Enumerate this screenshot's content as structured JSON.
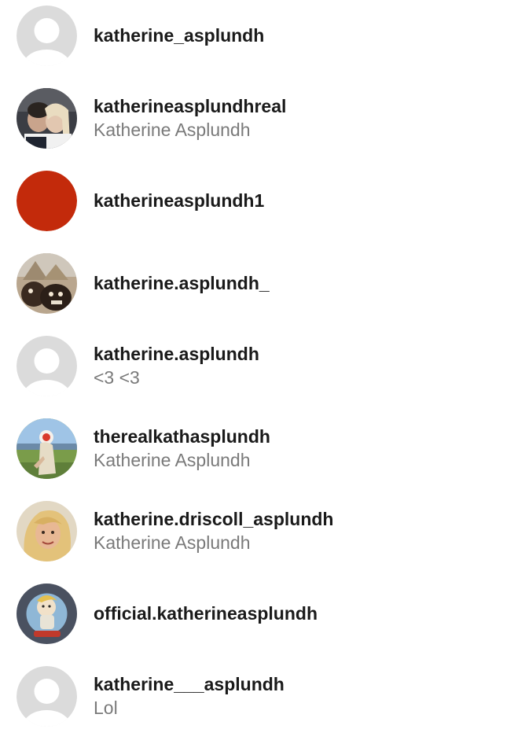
{
  "results": [
    {
      "username": "katherine_asplundh",
      "full_name": "",
      "avatar": "default-avatar-icon"
    },
    {
      "username": "katherineasplundhreal",
      "full_name": "Katherine Asplundh",
      "avatar": "photo-two-people"
    },
    {
      "username": "katherineasplundh1",
      "full_name": "",
      "avatar": "solid-red-avatar",
      "avatar_color": "#c32a0b"
    },
    {
      "username": "katherine.asplundh_",
      "full_name": "",
      "avatar": "photo-dogs-pyramids"
    },
    {
      "username": "katherine.asplundh",
      "full_name": "<3 <3",
      "avatar": "default-avatar-icon"
    },
    {
      "username": "therealkathasplundh",
      "full_name": "Katherine Asplundh",
      "avatar": "photo-woman-outdoors"
    },
    {
      "username": "katherine.driscoll_asplundh",
      "full_name": "Katherine Asplundh",
      "avatar": "photo-blonde-woman"
    },
    {
      "username": "official.katherineasplundh",
      "full_name": "",
      "avatar": "cartoon-illustration"
    },
    {
      "username": "katherine___asplundh",
      "full_name": "Lol",
      "avatar": "default-avatar-icon"
    }
  ],
  "colors": {
    "username_text": "#1a1a1a",
    "fullname_text": "#7a7a7a",
    "default_avatar_bg": "#dbdbdb",
    "default_avatar_fg": "#ffffff"
  }
}
